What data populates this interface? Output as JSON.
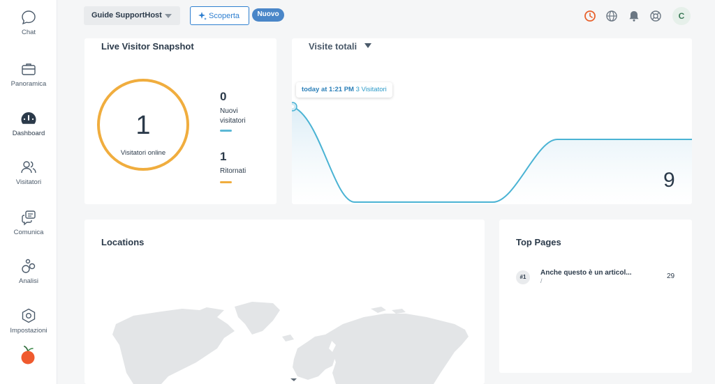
{
  "sidebar": {
    "items": [
      {
        "label": "Chat",
        "icon": "chat-bubble-icon"
      },
      {
        "label": "Panoramica",
        "icon": "briefcase-icon"
      },
      {
        "label": "Dashboard",
        "icon": "dashboard-gauge-icon"
      },
      {
        "label": "Visitatori",
        "icon": "users-icon"
      },
      {
        "label": "Comunica",
        "icon": "messages-icon"
      },
      {
        "label": "Analisi",
        "icon": "analytics-circles-icon"
      },
      {
        "label": "Impostazioni",
        "icon": "hexagon-settings-icon"
      }
    ],
    "active": "Dashboard"
  },
  "topbar": {
    "site_select": "Guide SupportHost",
    "discover_label": "Scoperta",
    "new_badge": "Nuovo",
    "avatar_letter": "C",
    "icons": [
      "clock-icon",
      "globe-icon",
      "bell-icon",
      "help-lifebuoy-icon"
    ]
  },
  "snapshot": {
    "title": "Live Visitor Snapshot",
    "online_count": "1",
    "online_label": "Visitatori online",
    "new_count": "0",
    "new_label_1": "Nuovi",
    "new_label_2": "visitatori",
    "returning_count": "1",
    "returning_label": "Ritornati"
  },
  "visits": {
    "title": "Visite totali",
    "tooltip_time": "today at 1:21 PM",
    "tooltip_value": "3 Visitatori",
    "total": "9"
  },
  "locations": {
    "title": "Locations"
  },
  "top_pages": {
    "title": "Top Pages",
    "rows": [
      {
        "rank": "#1",
        "title": "Anche questo è un articol...",
        "path": "/",
        "count": "29"
      }
    ]
  },
  "colors": {
    "accent_blue": "#2e7fd0",
    "ring_orange": "#f0ad3e",
    "new_bar_teal": "#5bb8d6",
    "line_blue": "#4ab3d4",
    "clock_orange": "#e8612c"
  }
}
